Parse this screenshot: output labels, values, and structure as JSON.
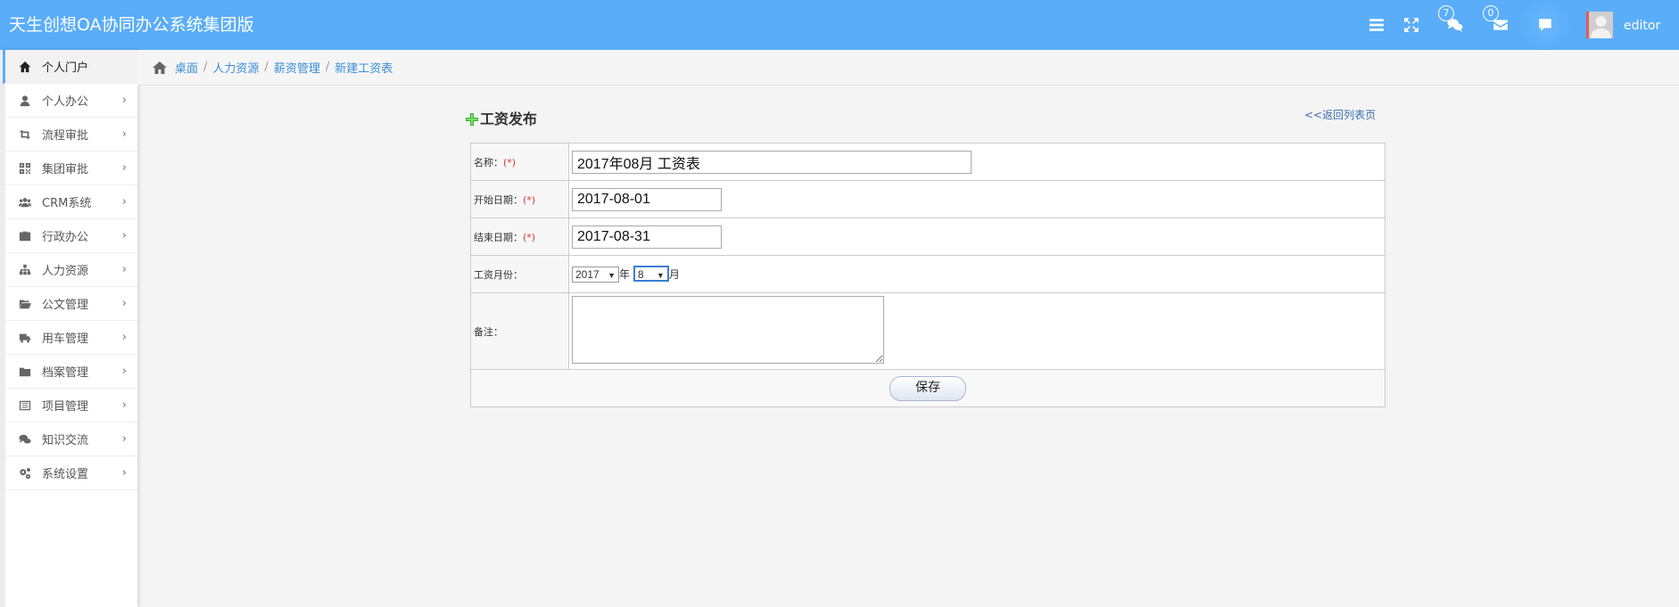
{
  "header": {
    "title": "天生创想OA协同办公系统集团版",
    "icons": [
      "menu-icon",
      "fullscreen-icon",
      "comments-icon",
      "envelope-icon",
      "chat-icon"
    ],
    "message_count": "7",
    "mail_count": "0",
    "username": "editor"
  },
  "sidebar": {
    "items": [
      {
        "label": "个人门户",
        "icon": "home-icon",
        "active": true
      },
      {
        "label": "个人办公",
        "icon": "user-icon"
      },
      {
        "label": "流程审批",
        "icon": "retweet-icon"
      },
      {
        "label": "集团审批",
        "icon": "qrcode-icon"
      },
      {
        "label": "CRM系统",
        "icon": "group-icon"
      },
      {
        "label": "行政办公",
        "icon": "briefcase-icon"
      },
      {
        "label": "人力资源",
        "icon": "sitemap-icon"
      },
      {
        "label": "公文管理",
        "icon": "folder-open-icon"
      },
      {
        "label": "用车管理",
        "icon": "truck-icon"
      },
      {
        "label": "档案管理",
        "icon": "folder-icon"
      },
      {
        "label": "项目管理",
        "icon": "list-alt-icon"
      },
      {
        "label": "知识交流",
        "icon": "comments-icon"
      },
      {
        "label": "系统设置",
        "icon": "cogs-icon"
      }
    ]
  },
  "breadcrumb": {
    "items": [
      "桌面",
      "人力资源",
      "薪资管理",
      "新建工资表"
    ],
    "separator": "/"
  },
  "form": {
    "title": "工资发布",
    "back_link": "<<返回列表页",
    "required_mark": "(*)",
    "name_label": "名称：",
    "name_value": "2017年08月 工资表",
    "start_label": "开始日期：",
    "start_value": "2017-08-01",
    "end_label": "结束日期：",
    "end_value": "2017-08-31",
    "month_label": "工资月份：",
    "year_value": "2017",
    "year_unit": "年",
    "month_value": "8",
    "month_unit": "月",
    "note_label": "备注：",
    "note_value": "",
    "save_label": "保存"
  },
  "colors": {
    "header_bg": "#5aadf9",
    "link": "#3a8fd9",
    "required": "#dd3333"
  }
}
